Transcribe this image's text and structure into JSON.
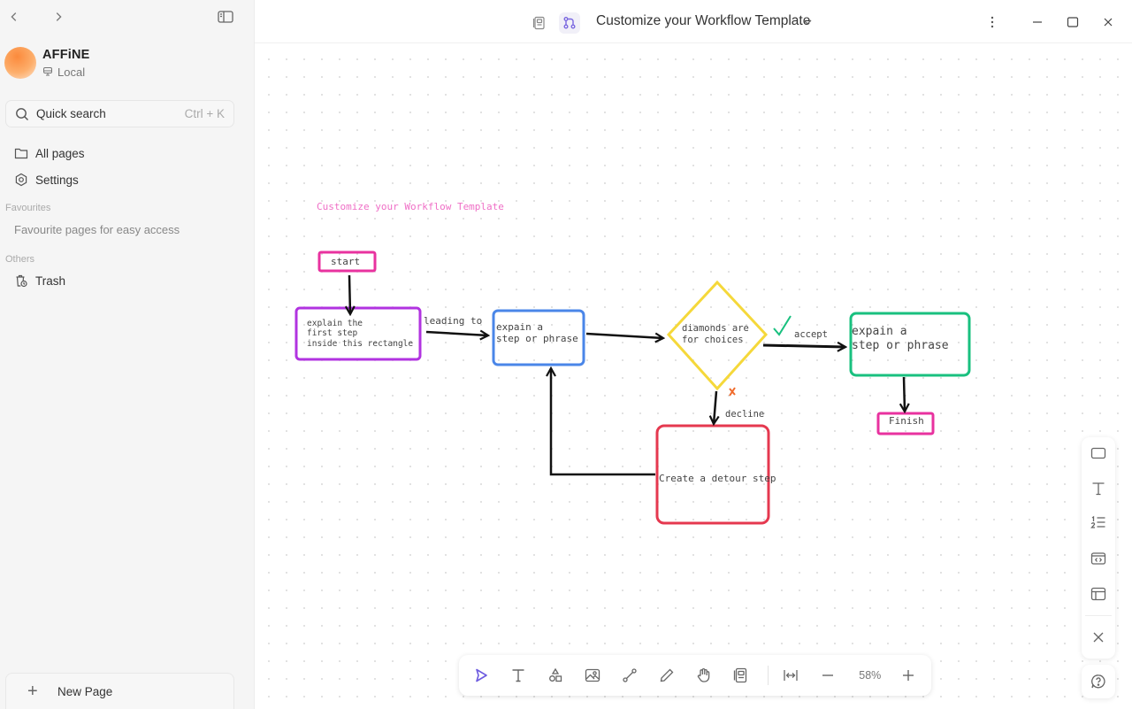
{
  "sidebar": {
    "workspace": {
      "name": "AFFiNE",
      "storage": "Local"
    },
    "search": {
      "label": "Quick search",
      "shortcut": "Ctrl + K"
    },
    "items": [
      {
        "label": "All pages",
        "icon": "folder-icon"
      },
      {
        "label": "Settings",
        "icon": "gear-icon"
      }
    ],
    "favourites": {
      "heading": "Favourites",
      "empty_text": "Favourite pages for easy access"
    },
    "others": {
      "heading": "Others",
      "items": [
        {
          "label": "Trash",
          "icon": "trash-icon"
        }
      ]
    },
    "new_page_label": "New Page"
  },
  "header": {
    "title": "Customize your Workflow Template",
    "mode": "edgeless"
  },
  "canvas": {
    "title_text": "Customize your Workflow Template",
    "nodes": {
      "start": "start",
      "first_step": "explain the\nfirst step\ninside this rectangle",
      "step_blue": "expain a\nstep or phrase",
      "diamond": "diamonds are\nfor choices",
      "step_green": "expain a\nstep or phrase",
      "detour": "Create a detour step",
      "finish": "Finish"
    },
    "edge_labels": {
      "leading_to": "leading to",
      "accept": "accept",
      "decline": "decline"
    },
    "colors": {
      "pink": "#e8329f",
      "purple": "#b133e0",
      "blue": "#4a86e8",
      "yellow": "#f5d83a",
      "green": "#19c07f",
      "red": "#e5384f",
      "check": "#19c07f",
      "cross": "#f06a2a"
    }
  },
  "toolbar": {
    "tools": [
      "select",
      "text",
      "shapes",
      "image",
      "connector",
      "pen",
      "hand",
      "note"
    ],
    "active_tool": "select",
    "zoom_level": "58%"
  },
  "right_panel": {
    "items": [
      "rectangle",
      "text",
      "numbered-list",
      "code-embed",
      "layout"
    ]
  }
}
